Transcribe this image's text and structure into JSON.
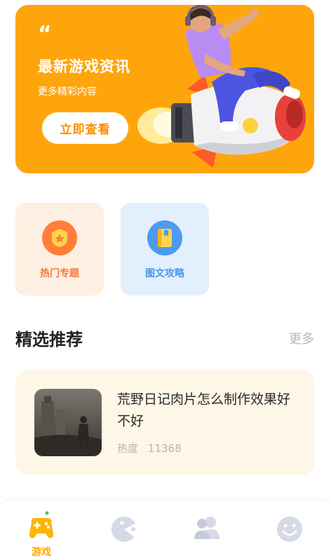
{
  "banner": {
    "quote_mark": "“",
    "title": "最新游戏资讯",
    "subtitle": "更多精彩内容",
    "button_label": "立即查看"
  },
  "categories": [
    {
      "label": "热门专题",
      "icon": "star-badge-icon"
    },
    {
      "label": "图文攻略",
      "icon": "book-icon"
    }
  ],
  "section": {
    "title": "精选推荐",
    "more_label": "更多"
  },
  "article": {
    "title": "荒野日记肉片怎么制作效果好不好",
    "heat_label": "热度",
    "heat_value": "11368"
  },
  "bottom_nav": {
    "items": [
      {
        "label": "游戏",
        "icon": "gamepad-icon",
        "active": true
      },
      {
        "label": "",
        "icon": "pacman-icon",
        "active": false
      },
      {
        "label": "",
        "icon": "users-icon",
        "active": false
      },
      {
        "label": "",
        "icon": "smiley-icon",
        "active": false
      }
    ]
  },
  "colors": {
    "banner_bg": "#ffa50c",
    "accent_orange": "#ff8f00",
    "hot_card_bg": "#fdefe1",
    "guide_card_bg": "#e2f0fd",
    "article_bg": "#fef7e7",
    "nav_active": "#ffa800",
    "nav_inactive": "#d6dae6"
  }
}
